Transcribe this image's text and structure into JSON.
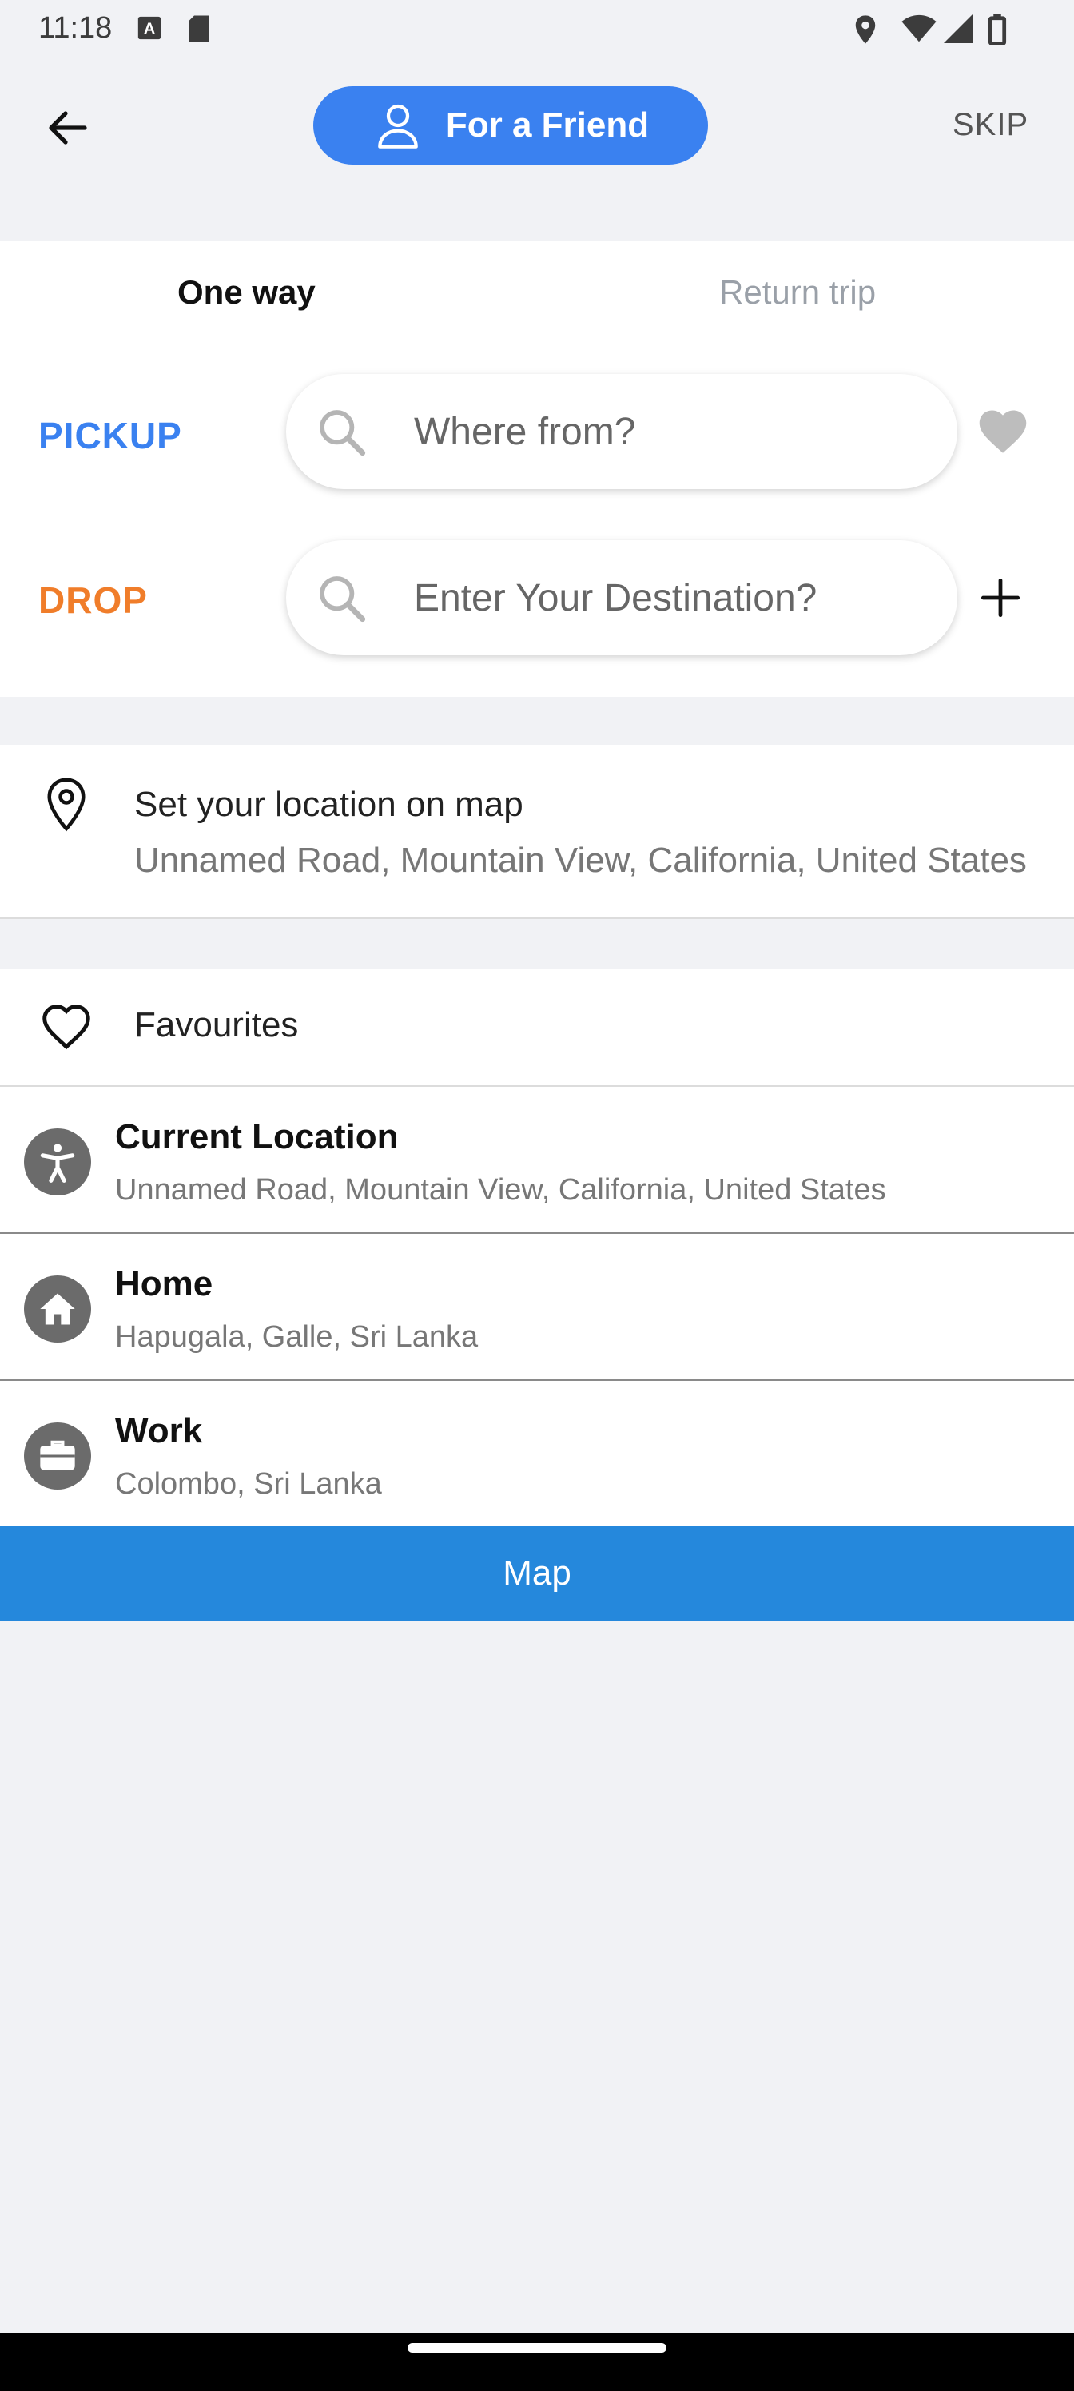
{
  "status_bar": {
    "time": "11:18",
    "icons": [
      "a-notification-icon",
      "sd-card-icon",
      "location-icon",
      "wifi-icon",
      "signal-icon",
      "battery-icon"
    ]
  },
  "top_bar": {
    "friend_label": "For a Friend",
    "skip_label": "SKIP"
  },
  "tabs": {
    "one_way": "One way",
    "return_trip": "Return trip"
  },
  "pickup": {
    "label": "PICKUP",
    "placeholder": "Where from?"
  },
  "drop": {
    "label": "DROP",
    "placeholder": "Enter Your Destination?"
  },
  "map_location": {
    "title": "Set your location on map",
    "address": "Unnamed Road, Mountain View, California, United States"
  },
  "favourites": {
    "title": "Favourites",
    "items": [
      {
        "name": "Current Location",
        "address": "Unnamed Road, Mountain View, California, United States",
        "icon": "accessibility-icon"
      },
      {
        "name": "Home",
        "address": "Hapugala, Galle, Sri Lanka",
        "icon": "home-icon"
      },
      {
        "name": "Work",
        "address": "Colombo, Sri Lanka",
        "icon": "briefcase-icon"
      }
    ]
  },
  "map_button": "Map",
  "colors": {
    "accent_blue": "#3a81f0",
    "drop_orange": "#f07d2a",
    "map_button": "#2588dc"
  }
}
